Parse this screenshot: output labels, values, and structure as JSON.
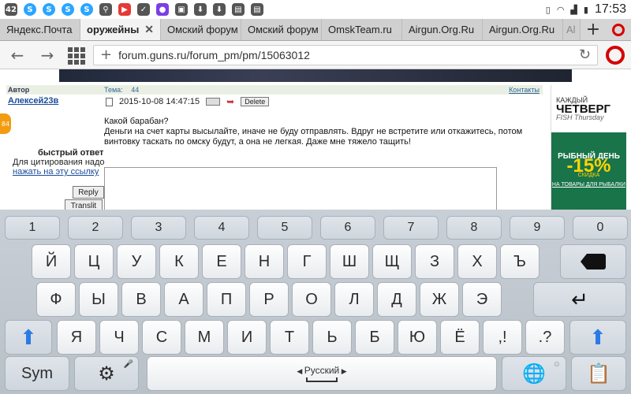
{
  "statusbar": {
    "left_badge": "42",
    "clock": "17:53",
    "icons": [
      "badge-icon",
      "s-icon",
      "s-icon",
      "s-icon",
      "s-icon",
      "usb-icon",
      "youtube-icon",
      "ok-icon",
      "chat-icon",
      "image-icon",
      "download-icon",
      "download-icon",
      "save-icon",
      "save-icon",
      "vibrate-icon",
      "wifi-icon",
      "signal-icon",
      "battery-icon"
    ]
  },
  "tabs": [
    {
      "label": "Яндекс.Почта"
    },
    {
      "label": "оружейны",
      "active": true
    },
    {
      "label": "Омский форум"
    },
    {
      "label": "Омский форум"
    },
    {
      "label": "OmskTeam.ru"
    },
    {
      "label": "Airgun.Org.Ru"
    },
    {
      "label": "Airgun.Org.Ru"
    },
    {
      "label": "Al"
    }
  ],
  "address": {
    "url": "forum.guns.ru/forum_pm/pm/15063012"
  },
  "forum": {
    "header": {
      "author_label": "Автор",
      "topic_label": "Тема:",
      "topic_value": "44",
      "contacts_label": "Контакты"
    },
    "author_name": "Алексей23в",
    "post_date": "2015-10-08 14:47:15",
    "delete_label": "Delete",
    "post_lines": [
      "Какой барабан?",
      "Деньги на счет карты высылайте, иначе не буду отправлять. Вдруг не встретите или откажитесь, потом",
      "винтовку таскать по омску будут, а она не легкая. Даже мне тяжело тащить!"
    ],
    "quick_reply_label": "быстрый ответ",
    "quote_hint": "Для цитирования надо",
    "quote_link": "нажать на эту ссылку",
    "reply_label": "Reply",
    "translit_label": "Translit",
    "side_badge": "84"
  },
  "ad": {
    "top_line1": "КАЖДЫЙ",
    "top_line2": "ЧЕТВЕРГ",
    "top_line3": "FISH Thursday",
    "bottom_line1": "РЫБНЫЙ ДЕНЬ",
    "bottom_big": "-15%",
    "bottom_small": "СКИДКА",
    "bottom_line2": "НА ТОВАРЫ ДЛЯ РЫБАЛКИ"
  },
  "keyboard": {
    "row_numbers": [
      "1",
      "2",
      "3",
      "4",
      "5",
      "6",
      "7",
      "8",
      "9",
      "0"
    ],
    "row1": [
      "Й",
      "Ц",
      "У",
      "К",
      "Е",
      "Н",
      "Г",
      "Ш",
      "Щ",
      "З",
      "Х",
      "Ъ"
    ],
    "row2": [
      "Ф",
      "Ы",
      "В",
      "А",
      "П",
      "Р",
      "О",
      "Л",
      "Д",
      "Ж",
      "Э"
    ],
    "row3": [
      "Я",
      "Ч",
      "С",
      "М",
      "И",
      "Т",
      "Ь",
      "Б",
      "Ю",
      "Ё",
      ",!",
      ".?"
    ],
    "sym_label": "Sym",
    "language_label": "Русский"
  },
  "colors": {
    "opera_red": "#d50000",
    "ad_green": "#19744a",
    "ad_yellow": "#ffd400",
    "link_blue": "#1a4c9a"
  }
}
